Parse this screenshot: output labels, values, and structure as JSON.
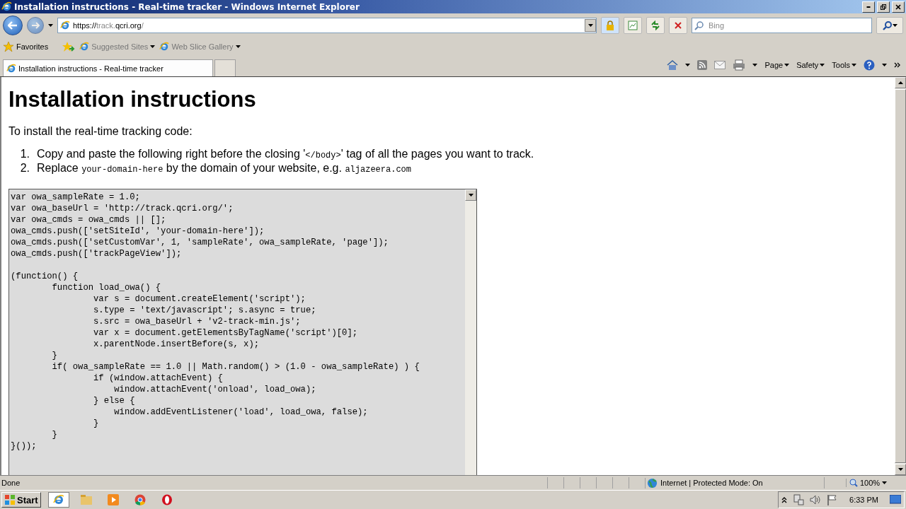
{
  "window": {
    "title": "Installation instructions - Real-time tracker - Windows Internet Explorer"
  },
  "address_bar": {
    "url_prefix": "https://",
    "url_host_start": "track.",
    "url_host": "qcri.org",
    "url_rest": "/"
  },
  "search": {
    "placeholder": "Bing"
  },
  "favorites_bar": {
    "favorites": "Favorites",
    "links": [
      "Suggested Sites",
      "Web Slice Gallery"
    ]
  },
  "tabs": [
    {
      "label": "Installation instructions - Real-time tracker",
      "selected": true
    }
  ],
  "command_bar": [
    "Page",
    "Safety",
    "Tools"
  ],
  "page": {
    "heading": "Installation instructions",
    "intro": "To install the real-time tracking code:",
    "steps": [
      {
        "number": "1.",
        "parts": [
          {
            "kind": "text",
            "text": "Copy and paste the following right before the closing '"
          },
          {
            "kind": "code",
            "text": "</body>"
          },
          {
            "kind": "text",
            "text": "' tag of all the pages you want to track."
          }
        ]
      },
      {
        "number": "2.",
        "parts": [
          {
            "kind": "text",
            "text": "Replace "
          },
          {
            "kind": "code",
            "text": "your-domain-here"
          },
          {
            "kind": "text",
            "text": " by the domain of your website, e.g. "
          },
          {
            "kind": "code",
            "text": "aljazeera.com"
          }
        ]
      }
    ],
    "code": "var owa_sampleRate = 1.0;\nvar owa_baseUrl = 'http://track.qcri.org/';\nvar owa_cmds = owa_cmds || [];\nowa_cmds.push(['setSiteId', 'your-domain-here']);\nowa_cmds.push(['setCustomVar', 1, 'sampleRate', owa_sampleRate, 'page']);\nowa_cmds.push(['trackPageView']);\n\n(function() {\n        function load_owa() {\n                var s = document.createElement('script');\n                s.type = 'text/javascript'; s.async = true;\n                s.src = owa_baseUrl + 'v2-track-min.js';\n                var x = document.getElementsByTagName('script')[0];\n                x.parentNode.insertBefore(s, x);\n        }\n        if( owa_sampleRate == 1.0 || Math.random() > (1.0 - owa_sampleRate) ) {\n                if (window.attachEvent) {\n                    window.attachEvent('onload', load_owa);\n                } else {\n                    window.addEventListener('load', load_owa, false);\n                }\n        }\n}());"
  },
  "status_bar": {
    "status": "Done",
    "zone": "Internet | Protected Mode: On",
    "zoom": "100%"
  },
  "taskbar": {
    "start": "Start",
    "clock": "6:33 PM"
  }
}
